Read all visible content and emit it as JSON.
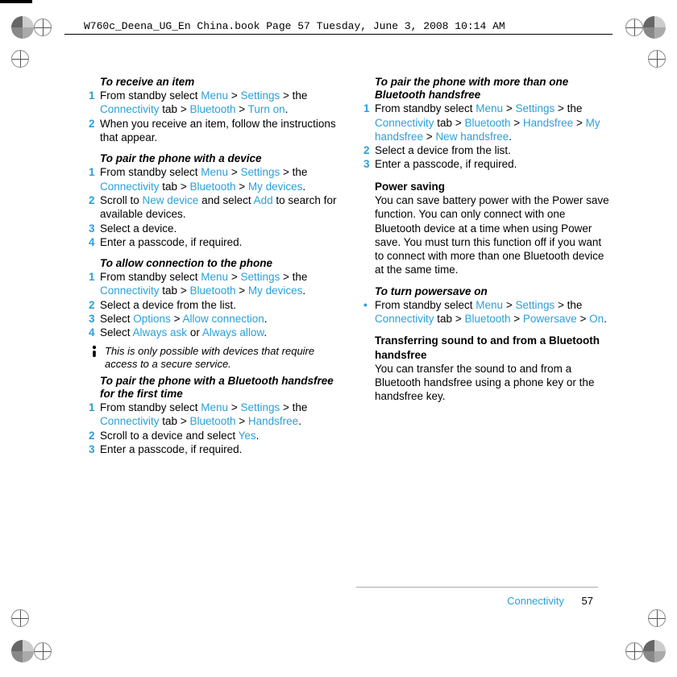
{
  "header": "W760c_Deena_UG_En China.book  Page 57  Tuesday, June 3, 2008  10:14 AM",
  "footer": {
    "section": "Connectivity",
    "page": "57"
  },
  "left": {
    "s1": {
      "title": "To receive an item",
      "step1a": "From standby select ",
      "step1_parts": [
        "Menu",
        " > ",
        "Settings",
        " > the ",
        "Connectivity",
        " tab > ",
        "Bluetooth",
        " > ",
        "Turn on",
        "."
      ],
      "step2": "When you receive an item, follow the instructions that appear."
    },
    "s2": {
      "title": "To pair the phone with a device",
      "step1a": "From standby select ",
      "step1_parts": [
        "Menu",
        " > ",
        "Settings",
        " > the ",
        "Connectivity",
        " tab > ",
        "Bluetooth",
        " > ",
        "My devices",
        "."
      ],
      "step2a": "Scroll to ",
      "step2b": "New device",
      "step2c": " and select ",
      "step2d": "Add",
      "step2e": " to search for available devices.",
      "step3": "Select a device.",
      "step4": "Enter a passcode, if required."
    },
    "s3": {
      "title": "To allow connection to the phone",
      "step1a": "From standby select ",
      "step1_parts": [
        "Menu",
        " > ",
        "Settings",
        " > the ",
        "Connectivity",
        " tab > ",
        "Bluetooth",
        " > ",
        "My devices",
        "."
      ],
      "step2": "Select a device from the list.",
      "step3a": "Select ",
      "step3b": "Options",
      "step3c": " > ",
      "step3d": "Allow connection",
      "step3e": ".",
      "step4a": "Select ",
      "step4b": "Always ask",
      "step4c": " or ",
      "step4d": "Always allow",
      "step4e": "."
    },
    "note": "This is only possible with devices that require access to a secure service.",
    "s4": {
      "title": "To pair the phone with a Bluetooth handsfree for the first time",
      "step1a": "From standby select ",
      "step1_parts": [
        "Menu",
        " > ",
        "Settings",
        " > the ",
        "Connectivity",
        " tab > ",
        "Bluetooth",
        " > ",
        "Handsfree",
        "."
      ],
      "step2a": "Scroll to a device and select ",
      "step2b": "Yes",
      "step2c": ".",
      "step3": "Enter a passcode, if required."
    }
  },
  "right": {
    "s5": {
      "title": "To pair the phone with more than one Bluetooth handsfree",
      "step1a": "From standby select ",
      "step1_parts": [
        "Menu",
        " > ",
        "Settings",
        " > the ",
        "Connectivity",
        " tab > ",
        "Bluetooth",
        " > ",
        "Handsfree",
        " > ",
        "My handsfree",
        " > ",
        "New handsfree",
        "."
      ],
      "step2": "Select a device from the list.",
      "step3": "Enter a passcode, if required."
    },
    "s6": {
      "title": "Power saving",
      "body": "You can save battery power with the Power save function. You can only connect with one Bluetooth device at a time when using Power save. You must turn this function off if you want to connect with more than one Bluetooth device at the same time."
    },
    "s7": {
      "title": "To turn powersave on",
      "step1a": "From standby select ",
      "step1_parts": [
        "Menu",
        " > ",
        "Settings",
        " > the ",
        "Connectivity",
        " tab > ",
        "Bluetooth",
        " > ",
        "Powersave",
        " > ",
        "On",
        "."
      ]
    },
    "s8": {
      "title": "Transferring sound to and from a Bluetooth handsfree",
      "body": "You can transfer the sound to and from a Bluetooth handsfree using a phone key or the handsfree key."
    }
  }
}
